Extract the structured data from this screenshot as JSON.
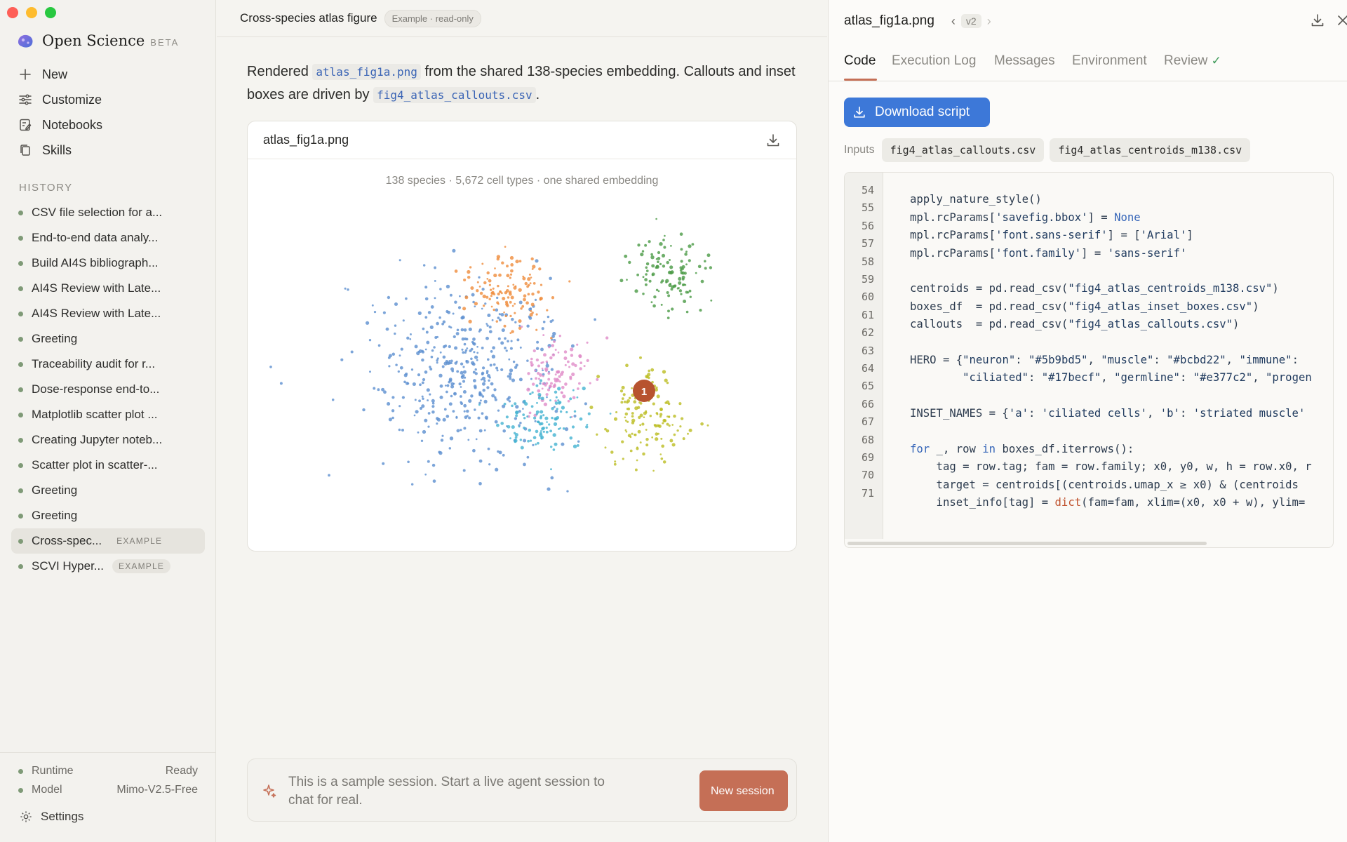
{
  "sidebar": {
    "brand": {
      "name": "Open Science",
      "tag": "BETA"
    },
    "nav": [
      {
        "label": "New",
        "icon": "plus-icon"
      },
      {
        "label": "Customize",
        "icon": "sliders-icon"
      },
      {
        "label": "Notebooks",
        "icon": "notebook-icon"
      },
      {
        "label": "Skills",
        "icon": "copy-icon"
      }
    ],
    "history_label": "HISTORY",
    "history": [
      {
        "label": "CSV file selection for a..."
      },
      {
        "label": "End-to-end data analy..."
      },
      {
        "label": "Build AI4S bibliograph..."
      },
      {
        "label": "AI4S Review with Late..."
      },
      {
        "label": "AI4S Review with Late..."
      },
      {
        "label": "Greeting"
      },
      {
        "label": "Traceability audit for r..."
      },
      {
        "label": "Dose-response end-to..."
      },
      {
        "label": "Matplotlib scatter plot ..."
      },
      {
        "label": "Creating Jupyter noteb..."
      },
      {
        "label": "Scatter plot in scatter-..."
      },
      {
        "label": "Greeting"
      },
      {
        "label": "Greeting"
      },
      {
        "label": "Cross-spec...",
        "badge": "EXAMPLE",
        "active": true
      },
      {
        "label": "SCVI Hyper...",
        "badge": "EXAMPLE"
      }
    ],
    "footer": {
      "runtime_label": "Runtime",
      "runtime_value": "Ready",
      "model_label": "Model",
      "model_value": "Mimo-V2.5-Free",
      "settings_label": "Settings"
    }
  },
  "center": {
    "title": "Cross-species atlas figure",
    "badge": "Example · read-only",
    "message": {
      "p1": "Rendered ",
      "file1": "atlas_fig1a.png",
      "p2": " from the shared 138-species embedding. Callouts and inset boxes are driven by ",
      "file2": "fig4_atlas_callouts.csv",
      "p3": "."
    },
    "figure": {
      "filename": "atlas_fig1a.png",
      "caption": "138 species · 5,672 cell types · one shared embedding",
      "callout": "1"
    },
    "composer": {
      "text": "This is a sample session. Start a live agent session to chat for real.",
      "button": "New session"
    }
  },
  "right": {
    "file_title": "atlas_fig1a.png",
    "version": "v2",
    "tabs": [
      "Code",
      "Execution Log",
      "Messages",
      "Environment",
      "Review"
    ],
    "active_tab": "Code",
    "download_label": "Download script",
    "inputs_label": "Inputs",
    "inputs": [
      "fig4_atlas_callouts.csv",
      "fig4_atlas_centroids_m138.csv"
    ],
    "line_numbers": [
      "54",
      "55",
      "56",
      "57",
      "58",
      "59",
      "60",
      "61",
      "62",
      "63",
      "64",
      "65",
      "66",
      "67",
      "68",
      "69",
      "70",
      "71"
    ],
    "code": [
      "",
      "apply_nature_style()",
      "mpl.rcParams['savefig.bbox'] = None",
      "mpl.rcParams['font.sans-serif'] = ['Arial']",
      "mpl.rcParams['font.family'] = 'sans-serif'",
      "",
      "centroids = pd.read_csv(\"fig4_atlas_centroids_m138.csv\")",
      "boxes_df  = pd.read_csv(\"fig4_atlas_inset_boxes.csv\")",
      "callouts  = pd.read_csv(\"fig4_atlas_callouts.csv\")",
      "",
      "HERO = {\"neuron\": \"#5b9bd5\", \"muscle\": \"#bcbd22\", \"immune\":",
      "        \"ciliated\": \"#17becf\", \"germline\": \"#e377c2\", \"progen",
      "",
      "INSET_NAMES = {'a': 'ciliated cells', 'b': 'striated muscle'",
      "",
      "for _, row in boxes_df.iterrows():",
      "    tag = row.tag; fam = row.family; x0, y0, w, h = row.x0, r",
      "    target = centroids[(centroids.umap_x >= x0) & (centroids",
      "    inset_info[tag] = dict(fam=fam, xlim=(x0, x0 + w), ylim="
    ]
  },
  "colors": {
    "accent": "#c56f56",
    "primary_button": "#3d78d8",
    "status_dot": "#7f9a77",
    "cluster_blue": "#5b8fd0",
    "cluster_orange": "#ef8c3c",
    "cluster_pink": "#e08cc8",
    "cluster_cyan": "#44b3d1",
    "cluster_green": "#4a9a45",
    "cluster_olive": "#bcbd22",
    "callout_marker": "#b7532f"
  }
}
